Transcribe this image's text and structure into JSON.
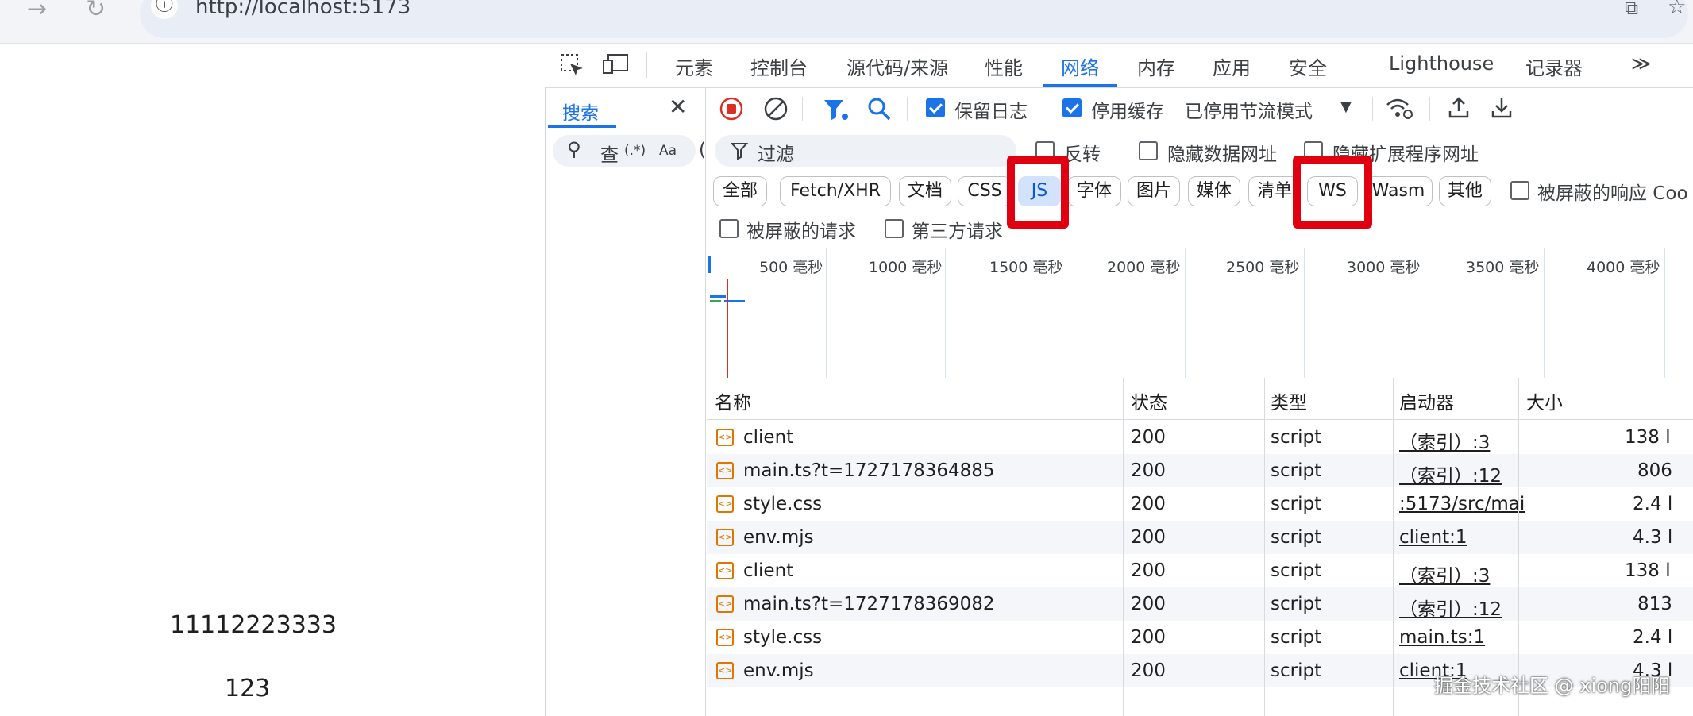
{
  "browser": {
    "url": "http://localhost:5173",
    "info_glyph": "ⓘ",
    "back_glyph": "→",
    "reload_glyph": "↻",
    "translate_glyph": "⧉",
    "star_glyph": "☆"
  },
  "page": {
    "line1": "11112223333",
    "line2": "123"
  },
  "devtools": {
    "tabs": [
      "元素",
      "控制台",
      "源代码/来源",
      "性能",
      "网络",
      "内存",
      "应用",
      "安全",
      "Lighthouse",
      "记录器"
    ],
    "active_tab": "网络",
    "more_glyph": "≫",
    "search_panel": {
      "title": "搜索",
      "close_glyph": "✕",
      "search_glyph": "⚲",
      "query_label": "查",
      "regex_label": "(.*)",
      "case_label": "Aa",
      "extra_label": "("
    },
    "toolbar": {
      "preserve_log_label": "保留日志",
      "preserve_log_checked": true,
      "disable_cache_label": "停用缓存",
      "disable_cache_checked": true,
      "throttle_label": "已停用节流模式",
      "throttle_arrow": "▼"
    },
    "filter": {
      "placeholder": "过滤",
      "invert_label": "反转",
      "hide_data_urls_label": "隐藏数据网址",
      "hide_ext_urls_label": "隐藏扩展程序网址"
    },
    "type_chips": [
      "全部",
      "Fetch/XHR",
      "文档",
      "CSS",
      "JS",
      "字体",
      "图片",
      "媒体",
      "清单",
      "WS",
      "Wasm",
      "其他"
    ],
    "selected_chip": "JS",
    "blocked_response_label": "被屏蔽的响应 Coo",
    "blocked_requests_label": "被屏蔽的请求",
    "third_party_label": "第三方请求",
    "timeline_ticks": [
      "500 毫秒",
      "1000 毫秒",
      "1500 毫秒",
      "2000 毫秒",
      "2500 毫秒",
      "3000 毫秒",
      "3500 毫秒",
      "4000 毫秒"
    ],
    "table": {
      "headers": [
        "名称",
        "状态",
        "类型",
        "启动器",
        "大小"
      ],
      "rows": [
        {
          "name": "client",
          "status": "200",
          "type": "script",
          "initiator": "（索引）:3",
          "size": "138 l"
        },
        {
          "name": "main.ts?t=1727178364885",
          "status": "200",
          "type": "script",
          "initiator": "（索引）:12",
          "size": "806"
        },
        {
          "name": "style.css",
          "status": "200",
          "type": "script",
          "initiator": ":5173/src/mai",
          "size": "2.4 l"
        },
        {
          "name": "env.mjs",
          "status": "200",
          "type": "script",
          "initiator": "client:1",
          "size": "4.3 l"
        },
        {
          "name": "client",
          "status": "200",
          "type": "script",
          "initiator": "（索引）:3",
          "size": "138 l"
        },
        {
          "name": "main.ts?t=1727178369082",
          "status": "200",
          "type": "script",
          "initiator": "（索引）:12",
          "size": "813"
        },
        {
          "name": "style.css",
          "status": "200",
          "type": "script",
          "initiator": "main.ts:1",
          "size": "2.4 l"
        },
        {
          "name": "env.mjs",
          "status": "200",
          "type": "script",
          "initiator": "client:1",
          "size": "4.3 l"
        }
      ]
    }
  },
  "watermark": "掘金技术社区 @ xiong阳阳",
  "colors": {
    "accent": "#1a73e8",
    "highlight": "#e0000f",
    "record": "#d93025"
  }
}
